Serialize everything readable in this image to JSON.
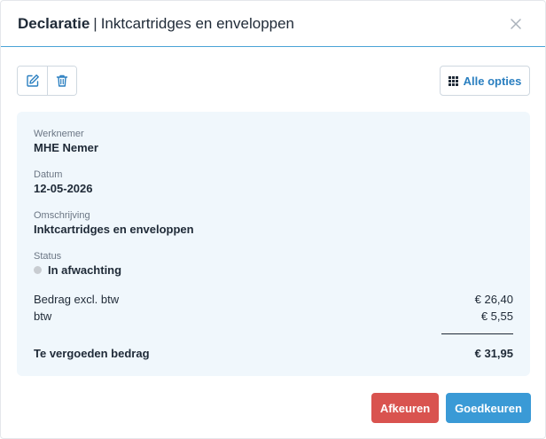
{
  "header": {
    "title_strong": "Declaratie",
    "separator": "|",
    "title_rest": "Inktcartridges en enveloppen"
  },
  "icons": {
    "close": "close-icon",
    "edit": "edit-icon",
    "delete": "trash-icon",
    "grid": "grid-icon"
  },
  "toolbar": {
    "options_label": "Alle opties"
  },
  "details": {
    "employee_label": "Werknemer",
    "employee_value": "MHE Nemer",
    "date_label": "Datum",
    "date_value": "12-05-2026",
    "description_label": "Omschrijving",
    "description_value": "Inktcartridges en enveloppen",
    "status_label": "Status",
    "status_value": "In afwachting"
  },
  "amounts": {
    "excl_label": "Bedrag excl. btw",
    "excl_value": "€ 26,40",
    "vat_label": "btw",
    "vat_value": "€ 5,55",
    "total_label": "Te vergoeden bedrag",
    "total_value": "€ 31,95"
  },
  "actions": {
    "reject_label": "Afkeuren",
    "approve_label": "Goedkeuren"
  },
  "colors": {
    "accent": "#3a9ad6",
    "reject": "#d9534f",
    "panel_bg": "#f0f7fc",
    "status_dot": "#c8ccd1"
  }
}
